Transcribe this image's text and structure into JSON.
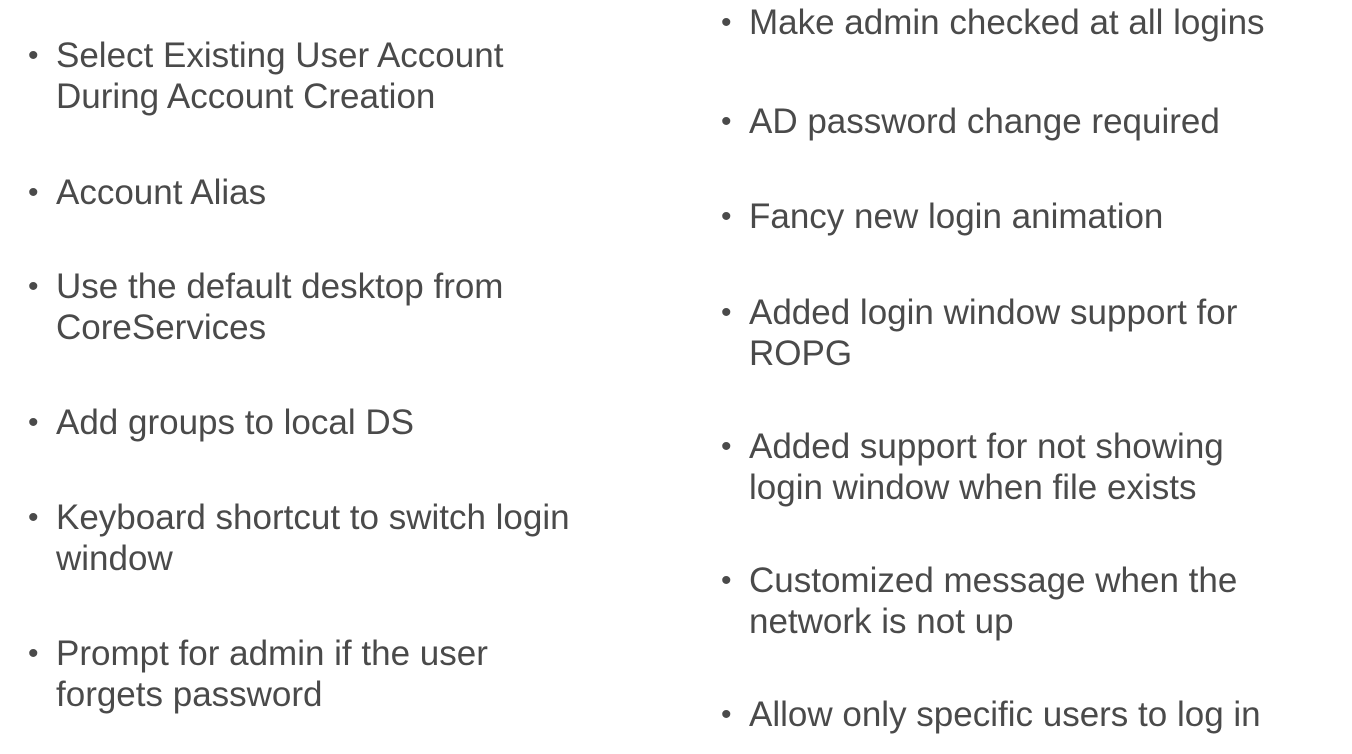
{
  "bullet_glyph": "•",
  "left_items": [
    "Select Existing User Account\nDuring Account Creation",
    "Account Alias",
    "Use the default desktop from\nCoreServices",
    "Add groups to local DS",
    "Keyboard shortcut to switch login\nwindow",
    "Prompt for admin if the user\nforgets password"
  ],
  "right_items": [
    "Make admin checked at all logins",
    "AD password change required",
    "Fancy new login animation",
    "Added login window support for\nROPG",
    "Added support for not showing\nlogin window when file exists",
    "Customized message when the\nnetwork is not up",
    "Allow only specific users to log in"
  ]
}
